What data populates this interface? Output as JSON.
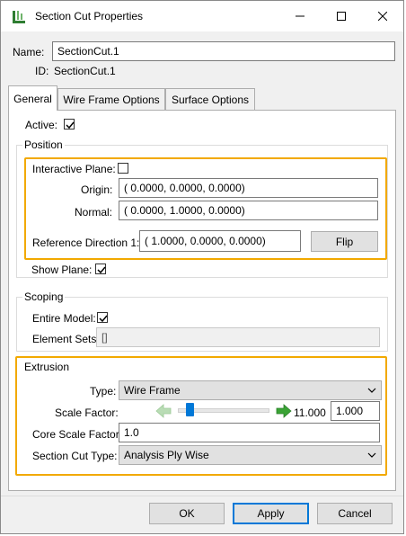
{
  "window": {
    "title": "Section Cut Properties",
    "minimize_glyph": "—",
    "maximize_glyph": "☐",
    "close_glyph": "✕"
  },
  "header": {
    "name_label": "Name:",
    "name_value": "SectionCut.1",
    "id_label": "ID:",
    "id_value": "SectionCut.1"
  },
  "tabs": [
    {
      "label": "General",
      "active": true
    },
    {
      "label": "Wire Frame Options",
      "active": false
    },
    {
      "label": "Surface Options",
      "active": false
    }
  ],
  "general": {
    "active_label": "Active:",
    "active_checked": true,
    "position": {
      "title": "Position",
      "interactive_plane_label": "Interactive Plane:",
      "interactive_plane_checked": false,
      "origin_label": "Origin:",
      "origin_value": "( 0.0000, 0.0000, 0.0000)",
      "normal_label": "Normal:",
      "normal_value": "( 0.0000, 1.0000, 0.0000)",
      "refdir_label": "Reference Direction 1:",
      "refdir_value": "( 1.0000, 0.0000, 0.0000)",
      "flip_label": "Flip",
      "show_plane_label": "Show Plane:",
      "show_plane_checked": true
    },
    "scoping": {
      "title": "Scoping",
      "entire_model_label": "Entire Model:",
      "entire_model_checked": true,
      "element_sets_label": "Element Sets:",
      "element_sets_value": "[]"
    },
    "extrusion": {
      "title": "Extrusion",
      "type_label": "Type:",
      "type_value": "Wire Frame",
      "scale_factor_label": "Scale Factor:",
      "scale_factor_max": "11.000",
      "scale_factor_value": "1.000",
      "scale_factor_fraction": 0.09,
      "core_scale_factor_label": "Core Scale Factor:",
      "core_scale_factor_value": "1.0",
      "section_cut_type_label": "Section Cut Type:",
      "section_cut_type_value": "Analysis Ply Wise"
    }
  },
  "footer": {
    "ok_label": "OK",
    "apply_label": "Apply",
    "cancel_label": "Cancel"
  },
  "colors": {
    "highlight": "#f2a900",
    "focus_border": "#0078d7",
    "arrow_green": "#3aa335",
    "arrow_green_disabled": "#b9dcb5"
  }
}
